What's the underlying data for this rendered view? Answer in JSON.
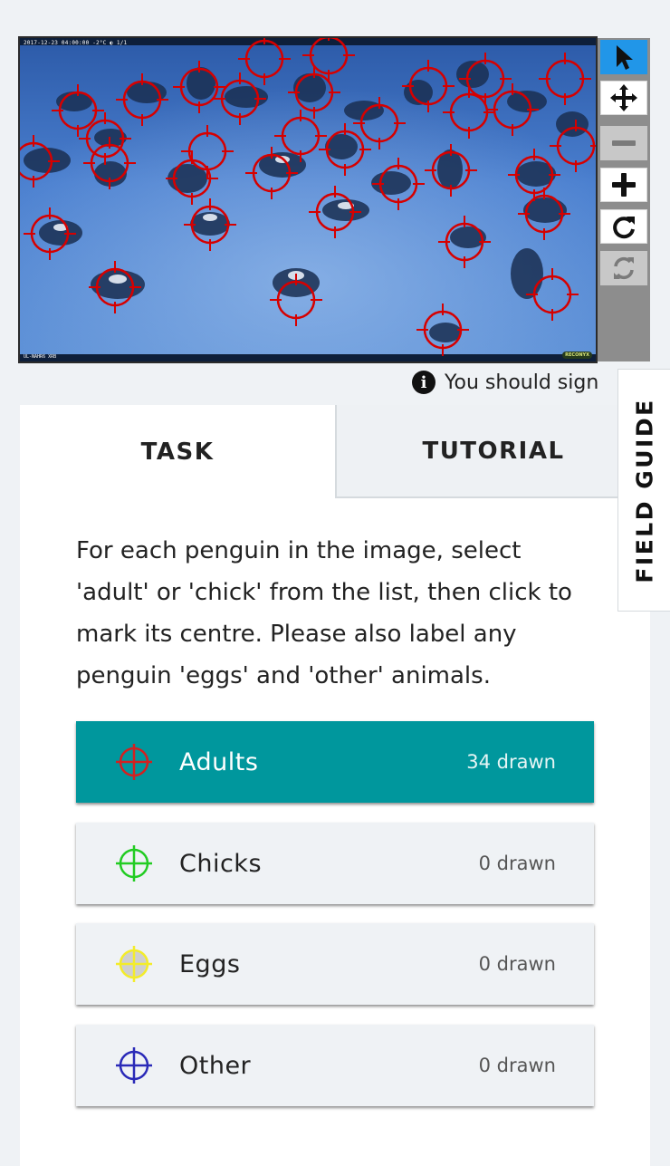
{
  "camera": {
    "stamp": "2017-12-23 04:00:00   -2°C ◐    1/1",
    "footer": "UL-NAHR6 XRB",
    "brand": "RECONYX"
  },
  "toolbar": {
    "tools": [
      {
        "icon": "pointer-icon",
        "state": "active"
      },
      {
        "icon": "move-icon",
        "state": "enabled"
      },
      {
        "icon": "zoom-out-icon",
        "state": "disabled"
      },
      {
        "icon": "zoom-in-icon",
        "state": "enabled"
      },
      {
        "icon": "rotate-icon",
        "state": "enabled"
      },
      {
        "icon": "reset-icon",
        "state": "disabled"
      }
    ]
  },
  "signin": {
    "text": "You should sign"
  },
  "tabs": {
    "task": "TASK",
    "tutorial": "TUTORIAL"
  },
  "field_guide": "FIELD GUIDE",
  "task": {
    "instructions": "For each penguin in the image, select 'adult' or 'chick' from the list, then click to mark its centre. Please also label any penguin 'eggs' and 'other' animals.",
    "choices": [
      {
        "label": "Adults",
        "count": "34 drawn",
        "color": "#d32020",
        "selected": true
      },
      {
        "label": "Chicks",
        "count": "0 drawn",
        "color": "#22cc22",
        "selected": false
      },
      {
        "label": "Eggs",
        "count": "0 drawn",
        "color": "#f3ec2a",
        "selected": false
      },
      {
        "label": "Other",
        "count": "0 drawn",
        "color": "#2a2ab8",
        "selected": false
      }
    ]
  },
  "colors": {
    "accent": "#00979d",
    "mark": "#d60000",
    "toolbar_active": "#2196e8"
  },
  "image_annotations": {
    "marker_type": "crosshair",
    "color": "#d60000"
  }
}
